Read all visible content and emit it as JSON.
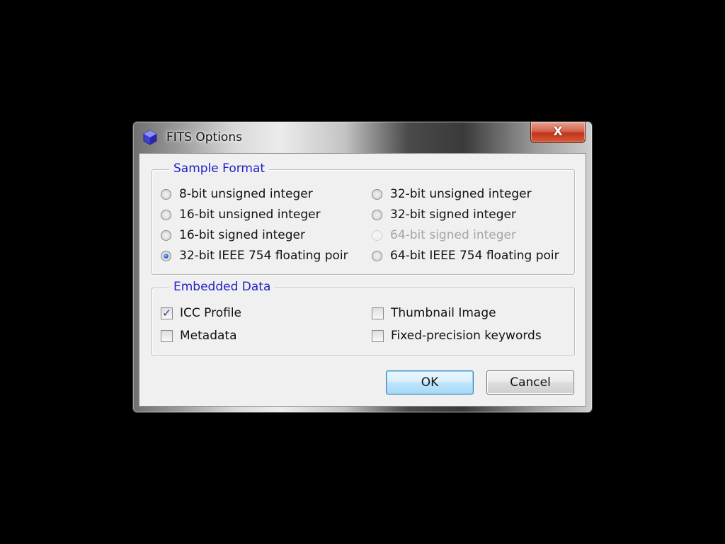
{
  "window": {
    "title": "FITS Options",
    "close_label": "X"
  },
  "sample_format": {
    "title": "Sample Format",
    "options": [
      {
        "label": "8-bit unsigned integer",
        "checked": false,
        "enabled": true
      },
      {
        "label": "16-bit unsigned integer",
        "checked": false,
        "enabled": true
      },
      {
        "label": "16-bit signed integer",
        "checked": false,
        "enabled": true
      },
      {
        "label": "32-bit IEEE 754 floating poir",
        "checked": true,
        "enabled": true
      },
      {
        "label": "32-bit unsigned integer",
        "checked": false,
        "enabled": true
      },
      {
        "label": "32-bit signed integer",
        "checked": false,
        "enabled": true
      },
      {
        "label": "64-bit signed integer",
        "checked": false,
        "enabled": false
      },
      {
        "label": "64-bit IEEE 754 floating poir",
        "checked": false,
        "enabled": true
      }
    ]
  },
  "embedded_data": {
    "title": "Embedded Data",
    "options": [
      {
        "label": "ICC Profile",
        "checked": true
      },
      {
        "label": "Metadata",
        "checked": false
      },
      {
        "label": "Thumbnail Image",
        "checked": false
      },
      {
        "label": "Fixed-precision keywords",
        "checked": false
      }
    ]
  },
  "buttons": {
    "ok_label": "OK",
    "cancel_label": "Cancel"
  }
}
